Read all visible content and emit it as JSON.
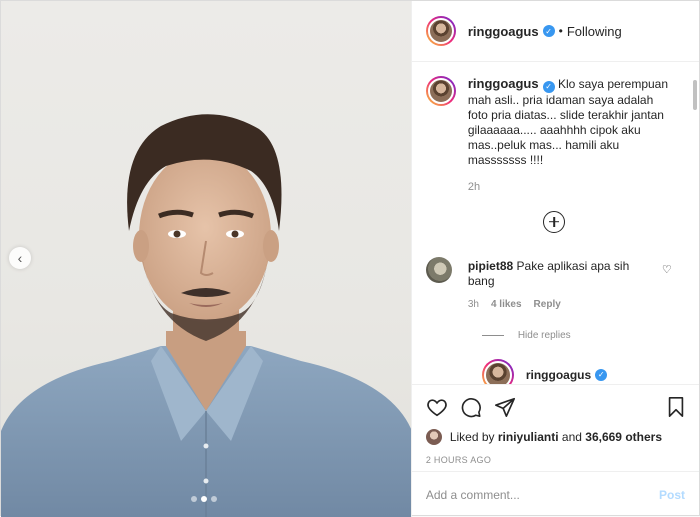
{
  "header": {
    "username": "ringgoagus",
    "follow_status": "Following"
  },
  "caption": {
    "username": "ringgoagus",
    "text": "Klo saya perempuan mah asli.. pria idaman saya adalah foto pria diatas... slide terakhir jantan gilaaaaaa..... aaahhhh cipok aku mas..peluk mas... hamili aku masssssss !!!!",
    "time": "2h"
  },
  "comment": {
    "username": "pipiet88",
    "text": "Pake aplikasi apa sih bang",
    "time": "3h",
    "likes": "4 likes",
    "reply_label": "Reply"
  },
  "replies": {
    "hide_label": "Hide replies",
    "first_reply_username": "ringgoagus"
  },
  "likes": {
    "prefix": "Liked by",
    "user": "riniyulianti",
    "and": "and",
    "others": "36,669 others"
  },
  "posted_ago": "2 HOURS AGO",
  "add_comment": {
    "placeholder": "Add a comment...",
    "post_label": "Post"
  },
  "icons": {
    "verified": "verified-badge-icon",
    "like": "heart-icon",
    "comment": "comment-icon",
    "share": "send-icon",
    "save": "bookmark-icon",
    "load_more": "plus-circle-icon",
    "prev": "chevron-left-icon"
  },
  "colors": {
    "verified_blue": "#3897f0",
    "post_button": "#b3dbff",
    "muted_text": "#8e8e8e"
  }
}
